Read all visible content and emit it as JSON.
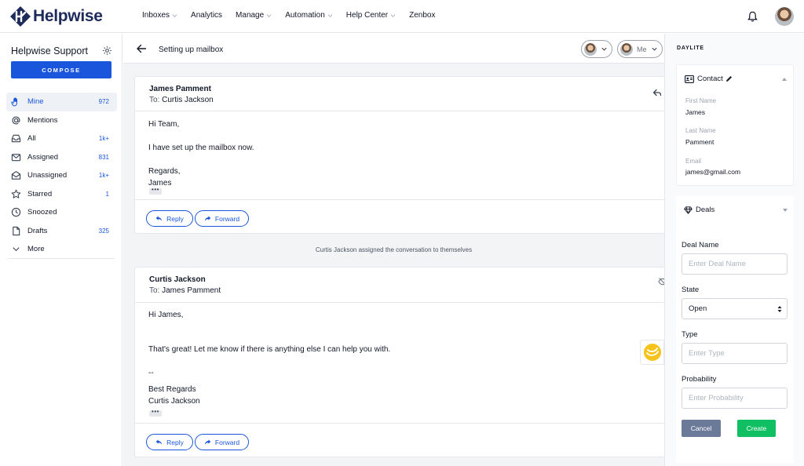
{
  "app": {
    "brand": "Helpwise",
    "brand_color": "#1e2a5a",
    "accent_color": "#1a56db"
  },
  "topnav": {
    "items": [
      {
        "label": "Inboxes",
        "dropdown": true
      },
      {
        "label": "Analytics",
        "dropdown": false
      },
      {
        "label": "Manage",
        "dropdown": true
      },
      {
        "label": "Automation",
        "dropdown": true
      },
      {
        "label": "Help Center",
        "dropdown": true
      },
      {
        "label": "Zenbox",
        "dropdown": false
      }
    ],
    "icons": [
      "bell-icon",
      "user-avatar"
    ]
  },
  "sidebar": {
    "team_name": "Helpwise Support",
    "compose_label": "COMPOSE",
    "items": [
      {
        "label": "Mine",
        "count": "972",
        "icon": "hand-icon",
        "active": true
      },
      {
        "label": "Mentions",
        "count": "",
        "icon": "at-icon",
        "active": false
      },
      {
        "label": "All",
        "count": "1k+",
        "icon": "inbox-icon",
        "active": false
      },
      {
        "label": "Assigned",
        "count": "831",
        "icon": "mail-icon",
        "active": false
      },
      {
        "label": "Unassigned",
        "count": "1k+",
        "icon": "mail-open-icon",
        "active": false
      },
      {
        "label": "Starred",
        "count": "1",
        "icon": "star-icon",
        "active": false
      },
      {
        "label": "Snoozed",
        "count": "",
        "icon": "clock-icon",
        "active": false
      },
      {
        "label": "Drafts",
        "count": "325",
        "icon": "file-icon",
        "active": false
      },
      {
        "label": "More",
        "count": "",
        "icon": "chevron-down-icon",
        "active": false
      }
    ]
  },
  "conversation": {
    "title": "Setting up mailbox",
    "assignee_pill": "",
    "me_pill": "Me",
    "system_message": "Curtis Jackson assigned the conversation to themselves",
    "messages": [
      {
        "from": "James Pamment",
        "to_label": "To:",
        "to": "Curtis Jackson",
        "lines": [
          "Hi Team,",
          "I have set up the mailbox now.",
          "Regards,",
          "James"
        ],
        "reply_label": "Reply",
        "forward_label": "Forward"
      },
      {
        "from": "Curtis Jackson",
        "to_label": "To:",
        "to": "James Pamment",
        "lines": [
          "Hi James,",
          "That's great! Let me know if there is anything else I can help you with.",
          "--",
          "Best Regards",
          "Curtis Jackson"
        ],
        "reply_label": "Reply",
        "forward_label": "Forward"
      }
    ]
  },
  "daylite": {
    "title": "DAYLITE",
    "contact": {
      "heading": "Contact",
      "fields": [
        {
          "label": "First Name",
          "value": "James"
        },
        {
          "label": "Last Name",
          "value": "Pamment"
        },
        {
          "label": "Email",
          "value": "james@gmail.com"
        }
      ]
    },
    "deals": {
      "heading": "Deals",
      "deal_name_label": "Deal Name",
      "deal_name_placeholder": "Enter Deal Name",
      "state_label": "State",
      "state_value": "Open",
      "type_label": "Type",
      "type_placeholder": "Enter Type",
      "probability_label": "Probability",
      "probability_placeholder": "Enter Probability",
      "cancel_label": "Cancel",
      "create_label": "Create"
    }
  }
}
